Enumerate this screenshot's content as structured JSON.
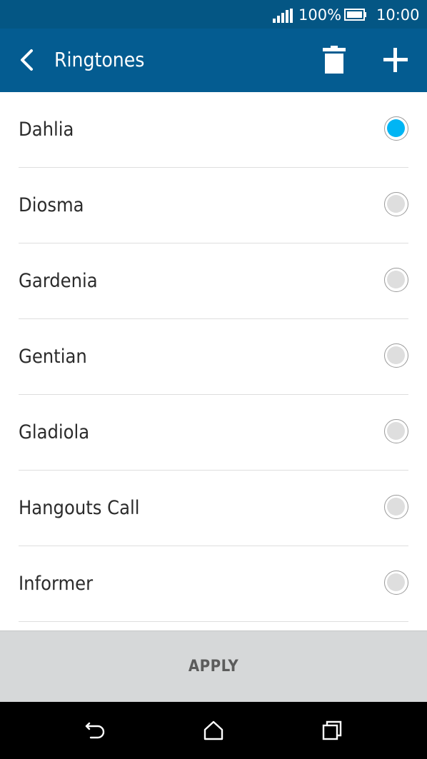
{
  "status_bar": {
    "battery_percent": "100%",
    "time": "10:00",
    "icons": [
      "signal-icon",
      "battery-icon"
    ]
  },
  "app_bar": {
    "title": "Ringtones",
    "icons": [
      "back-arrow-icon",
      "trash-icon",
      "plus-icon"
    ]
  },
  "ringtones": [
    {
      "label": "Dahlia",
      "selected": true
    },
    {
      "label": "Diosma",
      "selected": false
    },
    {
      "label": "Gardenia",
      "selected": false
    },
    {
      "label": "Gentian",
      "selected": false
    },
    {
      "label": "Gladiola",
      "selected": false
    },
    {
      "label": "Hangouts Call",
      "selected": false
    },
    {
      "label": "Informer",
      "selected": false
    }
  ],
  "apply": {
    "label": "APPLY"
  },
  "nav_bar": {
    "icons": [
      "back-icon",
      "home-icon",
      "recents-icon"
    ]
  },
  "colors": {
    "status_bar": "#045684",
    "app_bar": "#045c91",
    "radio_selected": "#00b5f4",
    "radio_unselected": "#dedede",
    "apply_bar": "#d6d8d9"
  }
}
